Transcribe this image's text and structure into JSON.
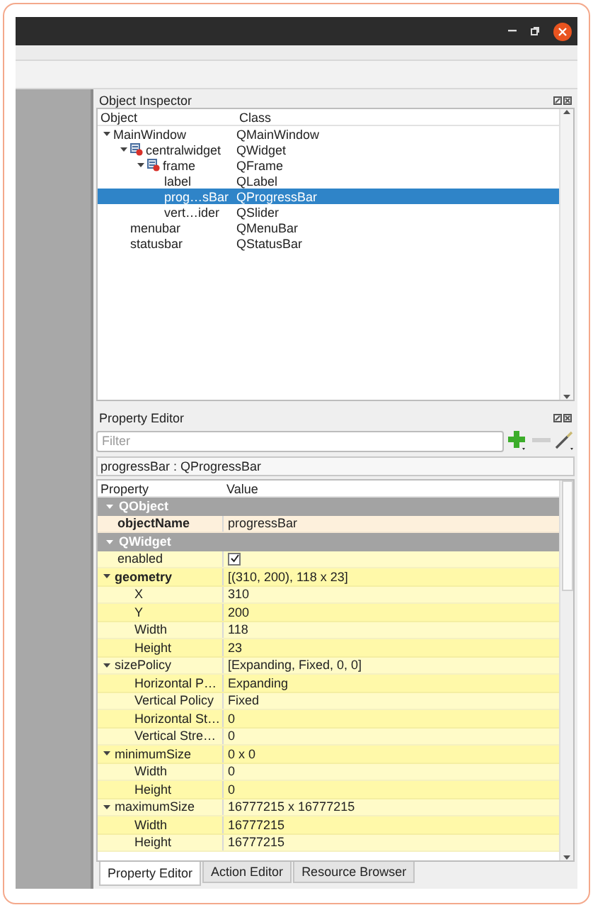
{
  "object_inspector": {
    "title": "Object Inspector",
    "columns": [
      "Object",
      "Class"
    ],
    "objects": [
      {
        "name": "MainWindow",
        "class": "QMainWindow",
        "broken_layout": false,
        "expanded": true,
        "selected": false,
        "children": [
          {
            "name": "centralwidget",
            "class": "QWidget",
            "broken_layout": true,
            "expanded": true,
            "selected": false,
            "children": [
              {
                "name": "frame",
                "class": "QFrame",
                "broken_layout": true,
                "expanded": true,
                "selected": false,
                "children": [
                  {
                    "name": "label",
                    "class": "QLabel",
                    "broken_layout": false,
                    "selected": false
                  },
                  {
                    "name": "prog…sBar",
                    "class": "QProgressBar",
                    "broken_layout": false,
                    "selected": true
                  },
                  {
                    "name": "vert…ider",
                    "class": "QSlider",
                    "broken_layout": false,
                    "selected": false
                  }
                ]
              }
            ]
          },
          {
            "name": "menubar",
            "class": "QMenuBar",
            "broken_layout": false,
            "selected": false
          },
          {
            "name": "statusbar",
            "class": "QStatusBar",
            "broken_layout": false,
            "selected": false
          }
        ]
      }
    ]
  },
  "property_editor": {
    "title": "Property Editor",
    "filter": {
      "placeholder": "Filter"
    },
    "object_label": "progressBar : QProgressBar",
    "columns": [
      "Property",
      "Value"
    ],
    "groups": [
      {
        "name": "QObject",
        "color": "#fdf0dc",
        "expanded": true,
        "properties": [
          {
            "name": "objectName",
            "value": "progressBar",
            "modified": true
          }
        ]
      },
      {
        "name": "QWidget",
        "color": "#fffbc8",
        "expanded": true,
        "properties": [
          {
            "name": "enabled",
            "kind": "checkbox",
            "checked": true,
            "modified": false
          },
          {
            "name": "geometry",
            "value": "[(310, 200), 118 x 23]",
            "modified": true,
            "expanded": true,
            "children": [
              {
                "name": "X",
                "value": "310",
                "modified": false
              },
              {
                "name": "Y",
                "value": "200",
                "modified": false
              },
              {
                "name": "Width",
                "value": "118",
                "modified": false
              },
              {
                "name": "Height",
                "value": "23",
                "modified": false
              }
            ]
          },
          {
            "name": "sizePolicy",
            "value": "[Expanding, Fixed, 0, 0]",
            "modified": false,
            "expanded": true,
            "children": [
              {
                "name": "Horizontal P…",
                "value": "Expanding",
                "modified": false
              },
              {
                "name": "Vertical Policy",
                "value": "Fixed",
                "modified": false
              },
              {
                "name": "Horizontal St…",
                "value": "0",
                "modified": false
              },
              {
                "name": "Vertical Stre…",
                "value": "0",
                "modified": false
              }
            ]
          },
          {
            "name": "minimumSize",
            "value": "0 x 0",
            "modified": false,
            "expanded": true,
            "children": [
              {
                "name": "Width",
                "value": "0",
                "modified": false
              },
              {
                "name": "Height",
                "value": "0",
                "modified": false
              }
            ]
          },
          {
            "name": "maximumSize",
            "value": "16777215 x 16777215",
            "modified": false,
            "expanded": true,
            "children": [
              {
                "name": "Width",
                "value": "16777215",
                "modified": false
              },
              {
                "name": "Height",
                "value": "16777215",
                "modified": false
              }
            ]
          }
        ]
      }
    ]
  },
  "tabs": [
    {
      "label": "Property Editor",
      "selected": true
    },
    {
      "label": "Action Editor",
      "selected": false
    },
    {
      "label": "Resource Browser",
      "selected": false
    }
  ]
}
